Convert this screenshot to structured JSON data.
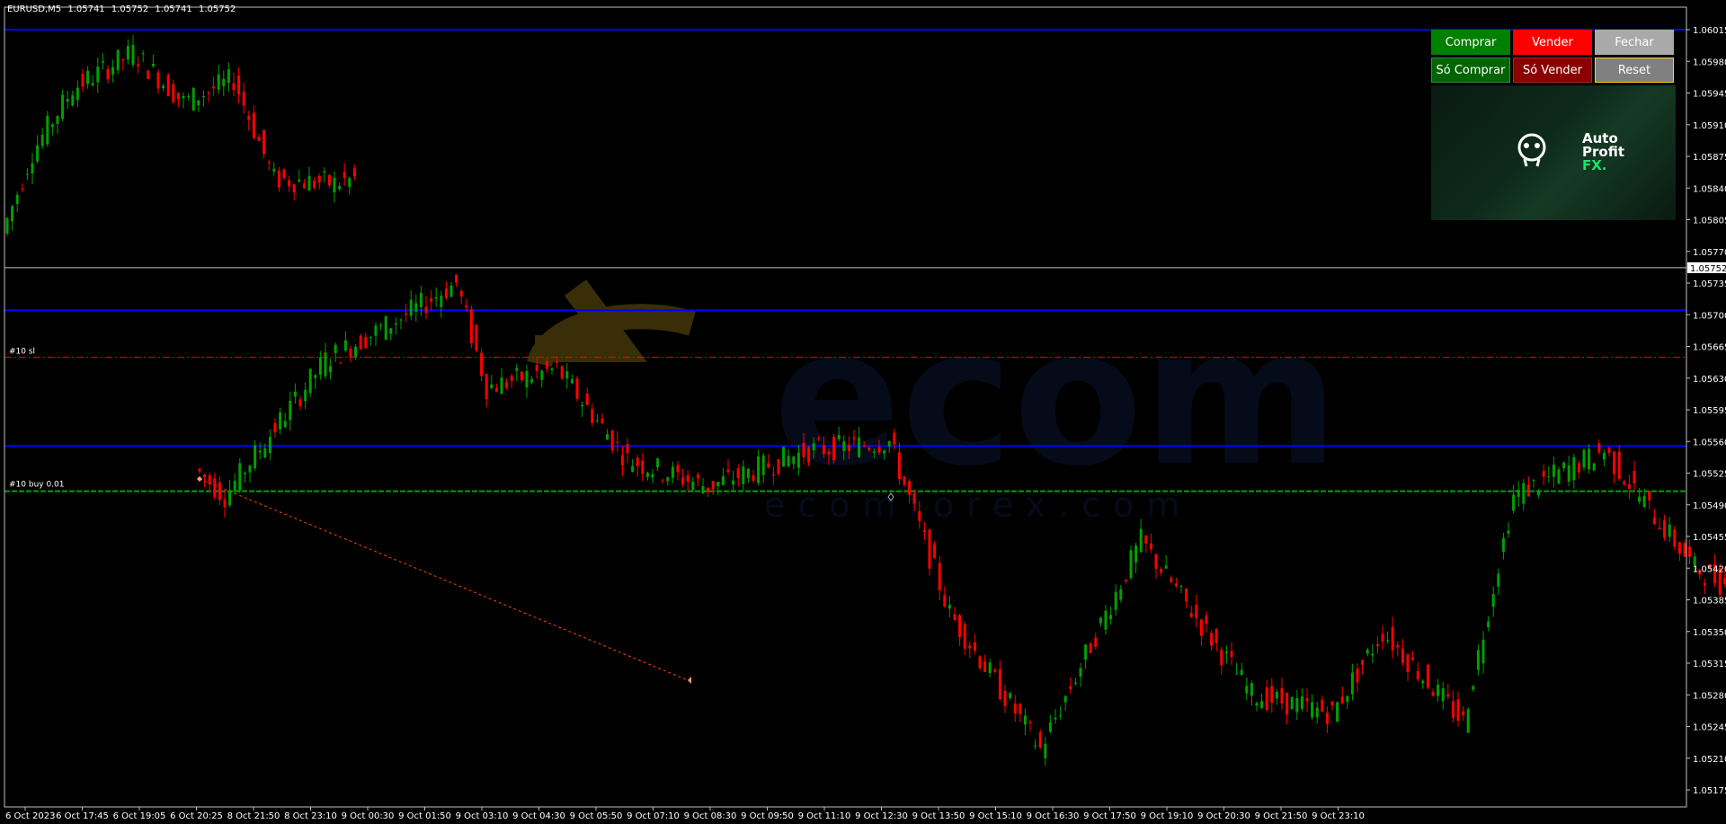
{
  "window": {
    "symbol": "EURUSD,M5",
    "ohlc": [
      "1.05741",
      "1.05752",
      "1.05741",
      "1.05752"
    ]
  },
  "price_axis": {
    "labels": [
      "1.06015",
      "1.05980",
      "1.05945",
      "1.05910",
      "1.05875",
      "1.05840",
      "1.05805",
      "1.05770",
      "1.05735",
      "1.05700",
      "1.05665",
      "1.05630",
      "1.05595",
      "1.05560",
      "1.05525",
      "1.05490",
      "1.05455",
      "1.05420",
      "1.05385",
      "1.05350",
      "1.05315",
      "1.05280",
      "1.05245",
      "1.05210",
      "1.05175"
    ],
    "current_price": "1.05752"
  },
  "time_axis": {
    "labels": [
      "6 Oct 2023",
      "6 Oct 17:45",
      "6 Oct 19:05",
      "6 Oct 20:25",
      "8 Oct 21:50",
      "8 Oct 23:10",
      "9 Oct 00:30",
      "9 Oct 01:50",
      "9 Oct 03:10",
      "9 Oct 04:30",
      "9 Oct 05:50",
      "9 Oct 07:10",
      "9 Oct 08:30",
      "9 Oct 09:50",
      "9 Oct 11:10",
      "9 Oct 12:30",
      "9 Oct 13:50",
      "9 Oct 15:10",
      "9 Oct 16:30",
      "9 Oct 17:50",
      "9 Oct 19:10",
      "9 Oct 20:30",
      "9 Oct 21:50",
      "9 Oct 23:10"
    ]
  },
  "levels": {
    "blue_lines": [
      1.06015,
      1.05705,
      1.05555
    ],
    "sl_line": {
      "price": 1.05653,
      "label": "#10 sl"
    },
    "buy_line": {
      "price": 1.05505,
      "label": "#10 buy 0.01"
    },
    "separator_price": 1.05752
  },
  "ea_panel": {
    "comprar": "Comprar",
    "vender": "Vender",
    "fechar": "Fechar",
    "so_comprar": "Só Comprar",
    "so_vender": "Só Vender",
    "reset": "Reset",
    "logo": {
      "line1": "Auto",
      "line2": "Profit",
      "line3": "FX."
    }
  },
  "watermark": {
    "big": "ecom",
    "small": "ecomforex.com"
  },
  "colors": {
    "bull": "#00a000",
    "bear": "#ff0000",
    "axis_text": "#ffffff",
    "blue_line": "#0000ff",
    "sl_line": "#ff0000",
    "buy_line": "#00a000"
  }
}
